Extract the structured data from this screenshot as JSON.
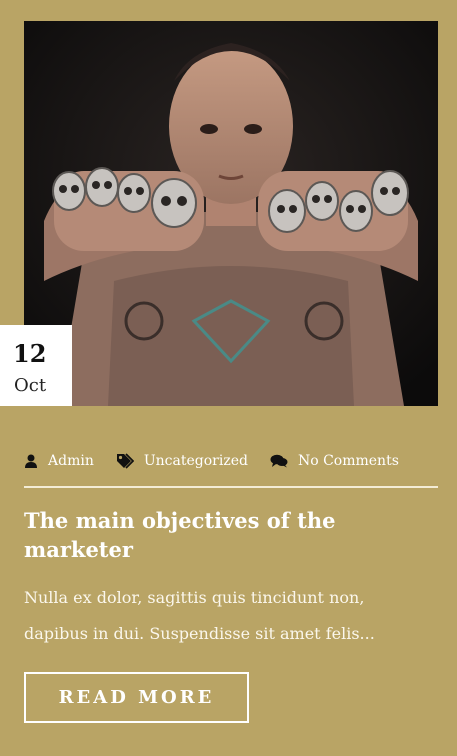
{
  "post": {
    "date": {
      "day": "12",
      "month": "Oct"
    },
    "meta": {
      "author": "Admin",
      "category": "Uncategorized",
      "comments": "No Comments"
    },
    "title": "The main objectives of the marketer",
    "excerpt": "Nulla ex dolor, sagittis quis tincidunt non, dapibus in dui. Suspendisse sit amet felis...",
    "read_more_label": "READ MORE"
  },
  "icons": {
    "author": "user-icon",
    "category": "tags-icon",
    "comments": "comments-icon"
  },
  "colors": {
    "background": "#b9a465",
    "text": "#ffffff",
    "date_box": "#ffffff"
  }
}
